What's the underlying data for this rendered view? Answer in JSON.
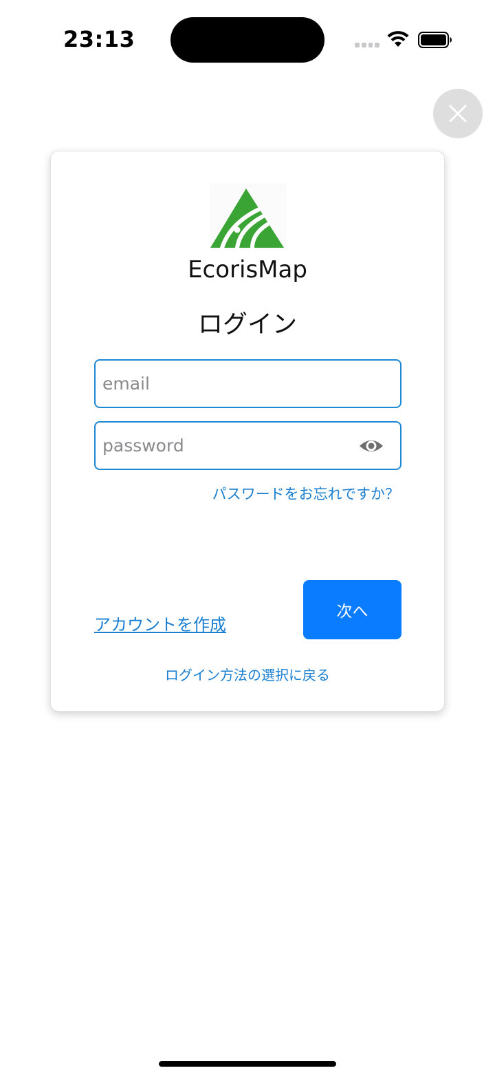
{
  "status_bar": {
    "time": "23:13"
  },
  "close_button": {
    "icon": "close-icon"
  },
  "card": {
    "logo_icon": "ecorismap-logo",
    "app_name": "EcorisMap",
    "title": "ログイン",
    "email": {
      "placeholder": "email",
      "value": ""
    },
    "password": {
      "placeholder": "password",
      "value": "",
      "toggle_icon": "eye-icon"
    },
    "forgot_password_label": "パスワードをお忘れですか？",
    "create_account_label": "アカウントを作成",
    "next_button_label": "次へ",
    "back_label": "ログイン方法の選択に戻る"
  },
  "colors": {
    "accent": "#0a7cff",
    "link": "#1a7fd1",
    "input_border": "#1e88d2",
    "logo_green": "#3aa434"
  }
}
